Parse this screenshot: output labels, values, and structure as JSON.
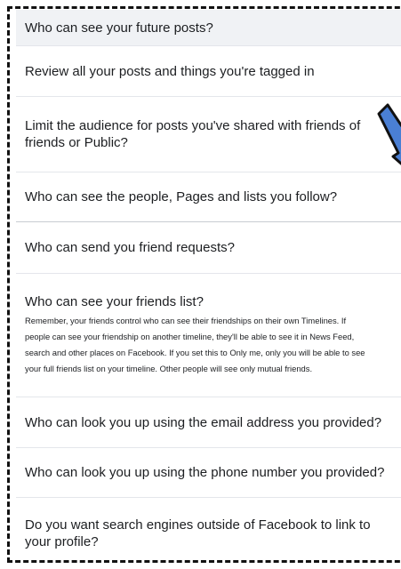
{
  "settings": {
    "items": [
      {
        "question": "Who can see your future posts?"
      },
      {
        "question": "Review all your posts and things you're tagged in"
      },
      {
        "question": "Limit the audience for posts you've shared with friends of friends or Public?"
      },
      {
        "question": "Who can see the people, Pages and lists you follow?"
      },
      {
        "question": "Who can send you friend requests?"
      },
      {
        "question": "Who can see your friends list?",
        "description": [
          "Remember, your friends control who can see their friendships on their own Timelines. If",
          "people can see your friendship on another timeline, they'll be able to see it in News Feed,",
          "search and other places on Facebook. If you set this to Only me, only you will be able to see",
          "your full friends list on your timeline. Other people will see only mutual friends."
        ]
      },
      {
        "question": "Who can look you up using the email address you provided?"
      },
      {
        "question": "Who can look you up using the phone number you provided?"
      },
      {
        "question": "Do you want search engines outside of Facebook to link to your profile?"
      }
    ]
  },
  "colors": {
    "highlight_row": "#f0f2f5",
    "divider": "#e4e6eb",
    "arrow_fill": "#4a7fd4",
    "frame_border": "#111111"
  },
  "icons": {
    "pointer": "arrow-pointer-icon"
  }
}
